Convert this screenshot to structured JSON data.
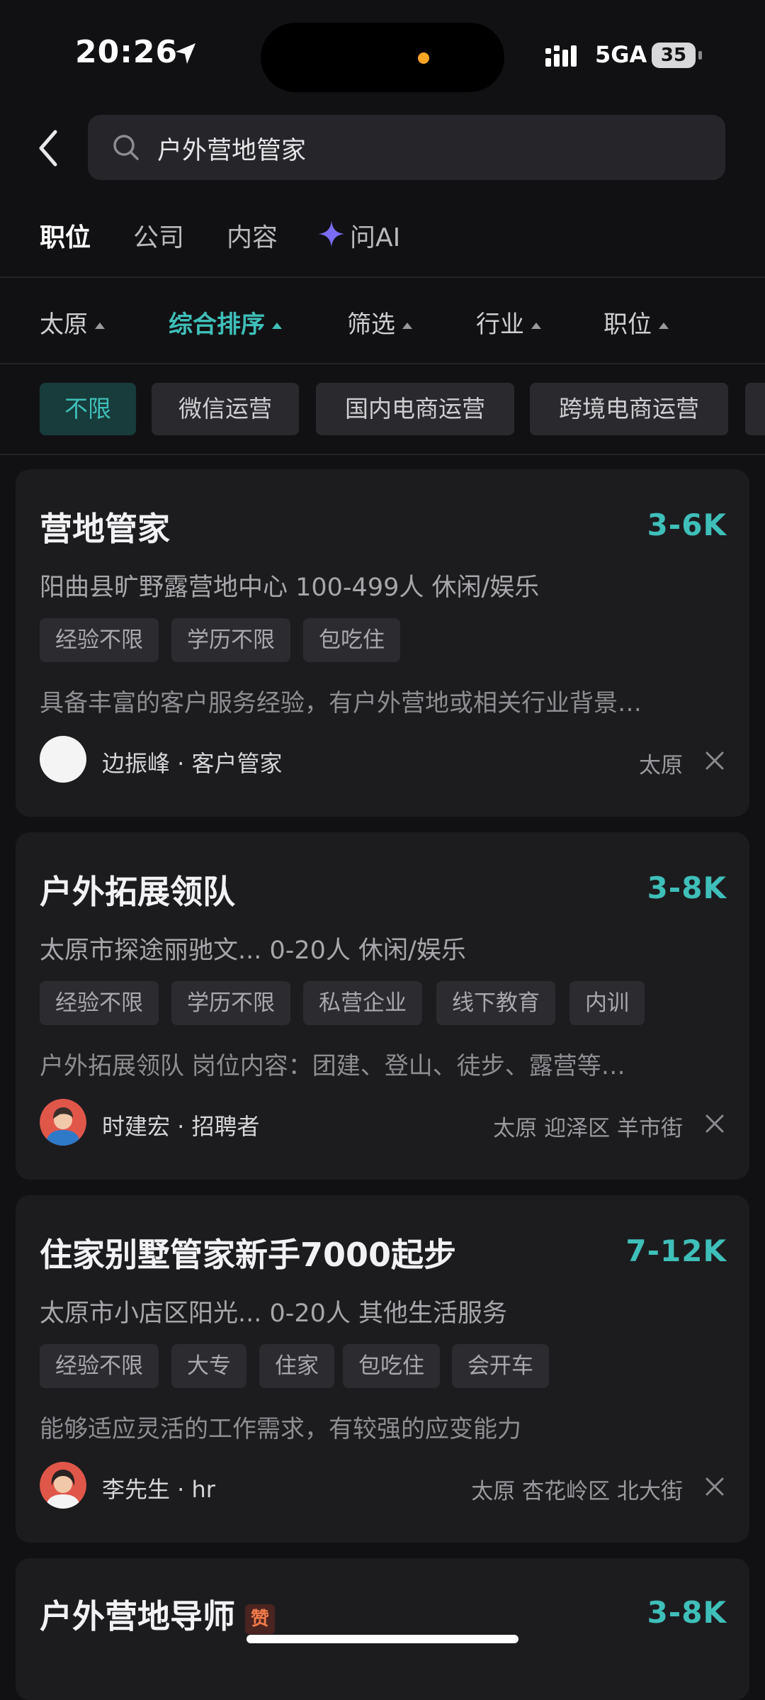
{
  "status_bar": {
    "time": "20:26",
    "network": "5GA",
    "battery": "35"
  },
  "search": {
    "query": "户外营地管家"
  },
  "tabs": [
    {
      "label": "职位",
      "active": true
    },
    {
      "label": "公司"
    },
    {
      "label": "内容"
    },
    {
      "label": "问AI"
    }
  ],
  "filters": [
    {
      "label": "太原"
    },
    {
      "label": "综合排序",
      "active": true
    },
    {
      "label": "筛选"
    },
    {
      "label": "行业"
    },
    {
      "label": "职位"
    }
  ],
  "chips": [
    "不限",
    "微信运营",
    "国内电商运营",
    "跨境电商运营"
  ],
  "jobs": [
    {
      "title": "营地管家",
      "salary": "3-6K",
      "company": "阳曲县旷野露营地中心 100-499人 休闲/娱乐",
      "tags": [
        "经验不限",
        "学历不限",
        "包吃住"
      ],
      "desc": "具备丰富的客户服务经验，有户外营地或相关行业背景…",
      "recruiter": "边振峰 · 客户管家",
      "location": "太原"
    },
    {
      "title": "户外拓展领队",
      "salary": "3-8K",
      "company": "太原市探途丽驰文... 0-20人 休闲/娱乐",
      "tags": [
        "经验不限",
        "学历不限",
        "私营企业",
        "线下教育",
        "内训"
      ],
      "desc": "户外拓展领队 岗位内容：团建、登山、徒步、露营等…",
      "recruiter": "时建宏 · 招聘者",
      "location": "太原 迎泽区 羊市街"
    },
    {
      "title": "住家别墅管家新手7000起步",
      "salary": "7-12K",
      "company": "太原市小店区阳光... 0-20人 其他生活服务",
      "tags": [
        "经验不限",
        "大专",
        "住家",
        "包吃住",
        "会开车"
      ],
      "desc": "能够适应灵活的工作需求，有较强的应变能力",
      "recruiter": "李先生 · hr",
      "location": "太原 杏花岭区 北大街"
    },
    {
      "title": "户外营地导师",
      "badge": "赞",
      "salary": "3-8K"
    }
  ],
  "colors": {
    "accent": "#3fbfb9",
    "background": "#111113",
    "card": "#1c1c1f"
  }
}
